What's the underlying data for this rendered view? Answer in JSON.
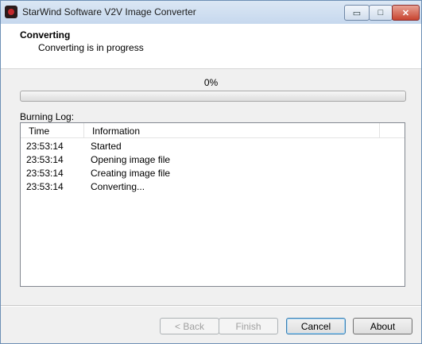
{
  "window": {
    "title": "StarWind Software V2V Image Converter",
    "controls": {
      "minimize": "▭",
      "maximize": "□",
      "close": "✕"
    }
  },
  "header": {
    "title": "Converting",
    "subtitle": "Converting is in progress"
  },
  "progress": {
    "label": "0%",
    "value": 0
  },
  "log": {
    "label": "Burning Log:",
    "columns": [
      "Time",
      "Information"
    ],
    "rows": [
      {
        "time": "23:53:14",
        "info": "Started"
      },
      {
        "time": "23:53:14",
        "info": "Opening image file"
      },
      {
        "time": "23:53:14",
        "info": "Creating image file"
      },
      {
        "time": "23:53:14",
        "info": "Converting..."
      }
    ]
  },
  "buttons": {
    "back": "< Back",
    "finish": "Finish",
    "cancel": "Cancel",
    "about": "About"
  },
  "colors": {
    "window_border": "#6d8fb5",
    "dialog_bg": "#f0f0f0",
    "progress_fill": "#2fae2f",
    "default_button_border": "#3c7fb1"
  }
}
